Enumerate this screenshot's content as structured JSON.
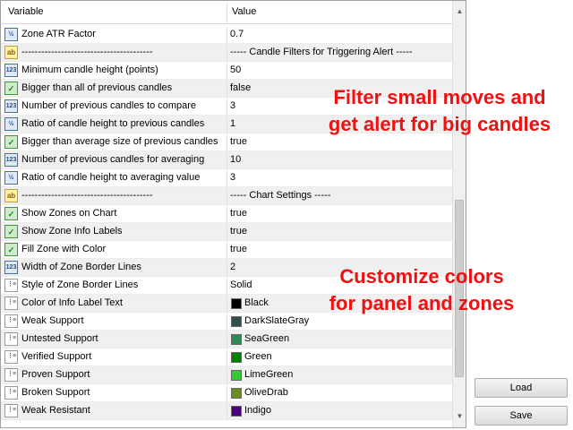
{
  "header": {
    "col_name": "Variable",
    "col_value": "Value"
  },
  "rows": [
    {
      "icon": "fraction-icon",
      "glyph": "½",
      "type": "frac",
      "name": "Zone ATR Factor",
      "value": "0.7"
    },
    {
      "icon": "string-icon",
      "glyph": "ab",
      "type": "str",
      "name": "----------------------------------------",
      "value": "----- Candle Filters for Triggering Alert -----"
    },
    {
      "icon": "integer-icon",
      "glyph": "123",
      "type": "num",
      "name": "Minimum candle height (points)",
      "value": "50"
    },
    {
      "icon": "boolean-icon",
      "glyph": "✓",
      "type": "bool",
      "name": "Bigger than all of previous candles",
      "value": "false"
    },
    {
      "icon": "integer-icon",
      "glyph": "123",
      "type": "num",
      "name": "Number of previous candles to compare",
      "value": "3"
    },
    {
      "icon": "fraction-icon",
      "glyph": "½",
      "type": "frac",
      "name": "Ratio of candle height to previous candles",
      "value": "1"
    },
    {
      "icon": "boolean-icon",
      "glyph": "✓",
      "type": "bool",
      "name": "Bigger than average size of previous candles",
      "value": "true"
    },
    {
      "icon": "integer-icon",
      "glyph": "123",
      "type": "num",
      "name": "Number of previous candles for averaging",
      "value": "10"
    },
    {
      "icon": "fraction-icon",
      "glyph": "½",
      "type": "frac",
      "name": "Ratio of candle height to averaging value",
      "value": "3"
    },
    {
      "icon": "string-icon",
      "glyph": "ab",
      "type": "str",
      "name": "----------------------------------------",
      "value": "----- Chart Settings -----"
    },
    {
      "icon": "boolean-icon",
      "glyph": "✓",
      "type": "bool",
      "name": "Show Zones on Chart",
      "value": "true"
    },
    {
      "icon": "boolean-icon",
      "glyph": "✓",
      "type": "bool",
      "name": "Show Zone Info Labels",
      "value": "true"
    },
    {
      "icon": "boolean-icon",
      "glyph": "✓",
      "type": "bool",
      "name": "Fill Zone with Color",
      "value": "true"
    },
    {
      "icon": "integer-icon",
      "glyph": "123",
      "type": "num",
      "name": "Width of Zone Border Lines",
      "value": "2"
    },
    {
      "icon": "list-icon",
      "glyph": "⋮≡",
      "type": "color",
      "name": "Style of Zone Border Lines",
      "value": "Solid"
    },
    {
      "icon": "color-icon",
      "glyph": "⋮≡",
      "type": "color",
      "name": "Color of Info Label Text",
      "value": "Black",
      "swatch": "#000000"
    },
    {
      "icon": "color-icon",
      "glyph": "⋮≡",
      "type": "color",
      "name": "Weak Support",
      "value": "DarkSlateGray",
      "swatch": "#2f4f4f"
    },
    {
      "icon": "color-icon",
      "glyph": "⋮≡",
      "type": "color",
      "name": "Untested Support",
      "value": "SeaGreen",
      "swatch": "#2e8b57"
    },
    {
      "icon": "color-icon",
      "glyph": "⋮≡",
      "type": "color",
      "name": "Verified Support",
      "value": "Green",
      "swatch": "#008000"
    },
    {
      "icon": "color-icon",
      "glyph": "⋮≡",
      "type": "color",
      "name": "Proven Support",
      "value": "LimeGreen",
      "swatch": "#32cd32"
    },
    {
      "icon": "color-icon",
      "glyph": "⋮≡",
      "type": "color",
      "name": "Broken Support",
      "value": "OliveDrab",
      "swatch": "#6b8e23"
    },
    {
      "icon": "color-icon",
      "glyph": "⋮≡",
      "type": "color",
      "name": "Weak Resistant",
      "value": "Indigo",
      "swatch": "#4b0082"
    }
  ],
  "annotations": {
    "filter_line1": "Filter small moves and",
    "filter_line2": "get alert for big candles",
    "colors_line1": "Customize colors",
    "colors_line2": "for panel and zones",
    "color": "#ee1111"
  },
  "buttons": {
    "load": "Load",
    "save": "Save"
  },
  "scrollbar": {
    "up": "▲",
    "down": "▼"
  }
}
